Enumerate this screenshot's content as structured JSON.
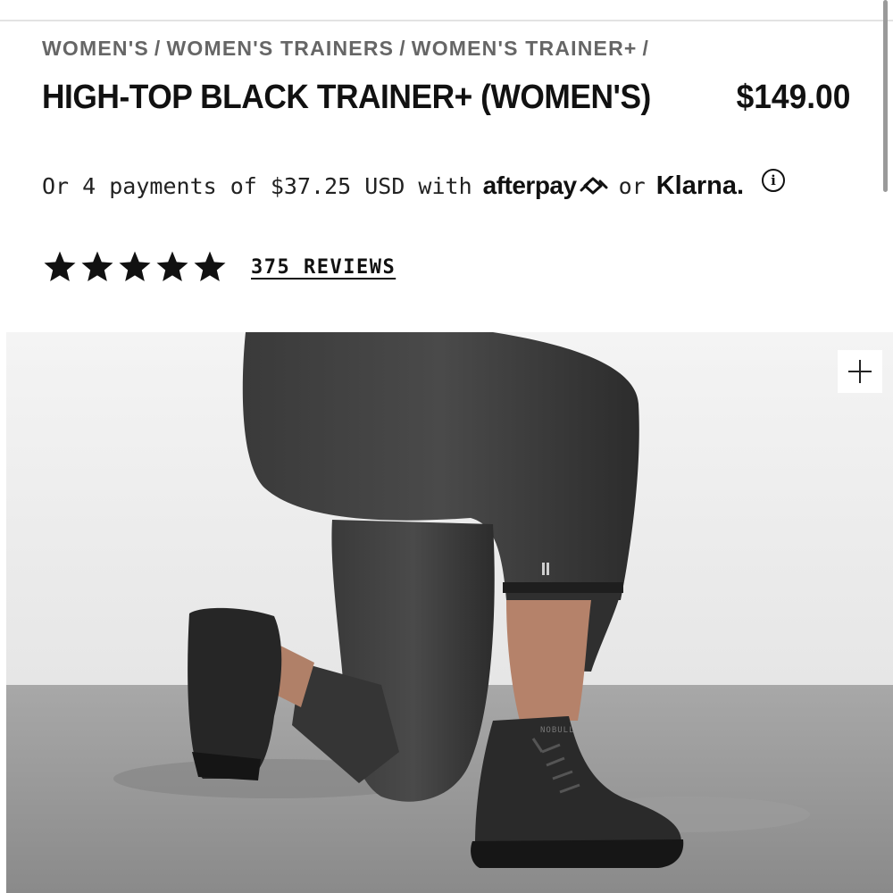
{
  "breadcrumb": {
    "items": [
      "WOMEN'S",
      "WOMEN'S TRAINERS",
      "WOMEN'S TRAINER+"
    ],
    "separator": "/"
  },
  "product": {
    "title": "HIGH-TOP BLACK TRAINER+ (WOMEN'S)",
    "price": "$149.00"
  },
  "payments": {
    "text": "Or 4 payments of $37.25 USD with",
    "afterpay_label": "afterpay",
    "or_label": "or",
    "klarna_label": "Klarna.",
    "info_icon": "info-icon"
  },
  "rating": {
    "stars": 5,
    "max_stars": 5,
    "reviews_label": "375 REVIEWS"
  },
  "hero": {
    "zoom_icon": "plus-icon",
    "shoe_brand_text": "NOBULL"
  },
  "colors": {
    "text": "#111111",
    "breadcrumb": "#666666",
    "divider": "#e3e3e3"
  }
}
